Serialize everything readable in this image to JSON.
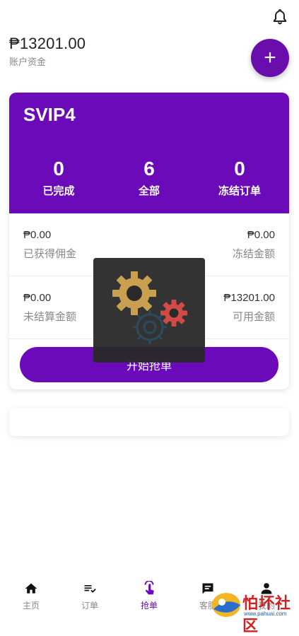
{
  "header": {
    "balance": "₱13201.00",
    "balance_label": "账户资金",
    "add_label": "+"
  },
  "card": {
    "level": "SVIP4",
    "stats": [
      {
        "value": "0",
        "label": "已完成"
      },
      {
        "value": "6",
        "label": "全部"
      },
      {
        "value": "0",
        "label": "冻结订单"
      }
    ],
    "money": [
      {
        "value": "₱0.00",
        "label": "已获得佣金"
      },
      {
        "value": "₱0.00",
        "label": "冻结金额"
      },
      {
        "value": "₱0.00",
        "label": "未结算金额"
      },
      {
        "value": "₱13201.00",
        "label": "可用金额"
      }
    ],
    "start_button": "开始抢单"
  },
  "tabs": [
    {
      "label": "主页",
      "icon": "home-icon"
    },
    {
      "label": "订单",
      "icon": "order-list-icon"
    },
    {
      "label": "抢单",
      "icon": "grab-order-icon"
    },
    {
      "label": "客服",
      "icon": "message-icon"
    },
    {
      "label": "我的",
      "icon": "user-icon"
    }
  ],
  "watermark": {
    "text": "怕坏社区",
    "url": "www.pahuai.com"
  },
  "colors": {
    "primary": "#6a0ab8",
    "tab_active": "#6a0ab8"
  }
}
